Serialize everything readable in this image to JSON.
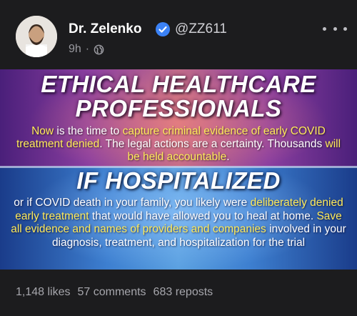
{
  "post": {
    "author_name": "Dr. Zelenko",
    "handle": "@ZZ611",
    "time": "9h",
    "separator": "·",
    "verified_icon": "verified-badge-icon",
    "visibility_icon": "globe-icon",
    "more_icon": "more-options-icon"
  },
  "image": {
    "title1_line1": "ETHICAL HEALTHCARE",
    "title1_line2": "PROFESSIONALS",
    "para1": {
      "s1": "Now",
      "s2": " is the time to ",
      "s3": "capture criminal evidence of early COVID treatment denied",
      "s4": ". The legal actions are a certainty. Thousands ",
      "s5": "will be held accountable",
      "s6": "."
    },
    "title2": "IF HOSPITALIZED",
    "para2": {
      "s1": "or if COVID death in your family, you likely were ",
      "s2": "deliberately denied early treatment",
      "s3": " that would have allowed you to heal at home.  ",
      "s4": "Save all evidence and names of providers and companies",
      "s5": " involved in your diagnosis, treatment, and hospitalization for the trial"
    }
  },
  "stats": {
    "likes": "1,148 likes",
    "comments": "57 comments",
    "reposts": "683 reposts"
  },
  "colors": {
    "background": "#1c1c1e",
    "highlight": "#ffeb5a",
    "verified_blue": "#3b82f6"
  }
}
